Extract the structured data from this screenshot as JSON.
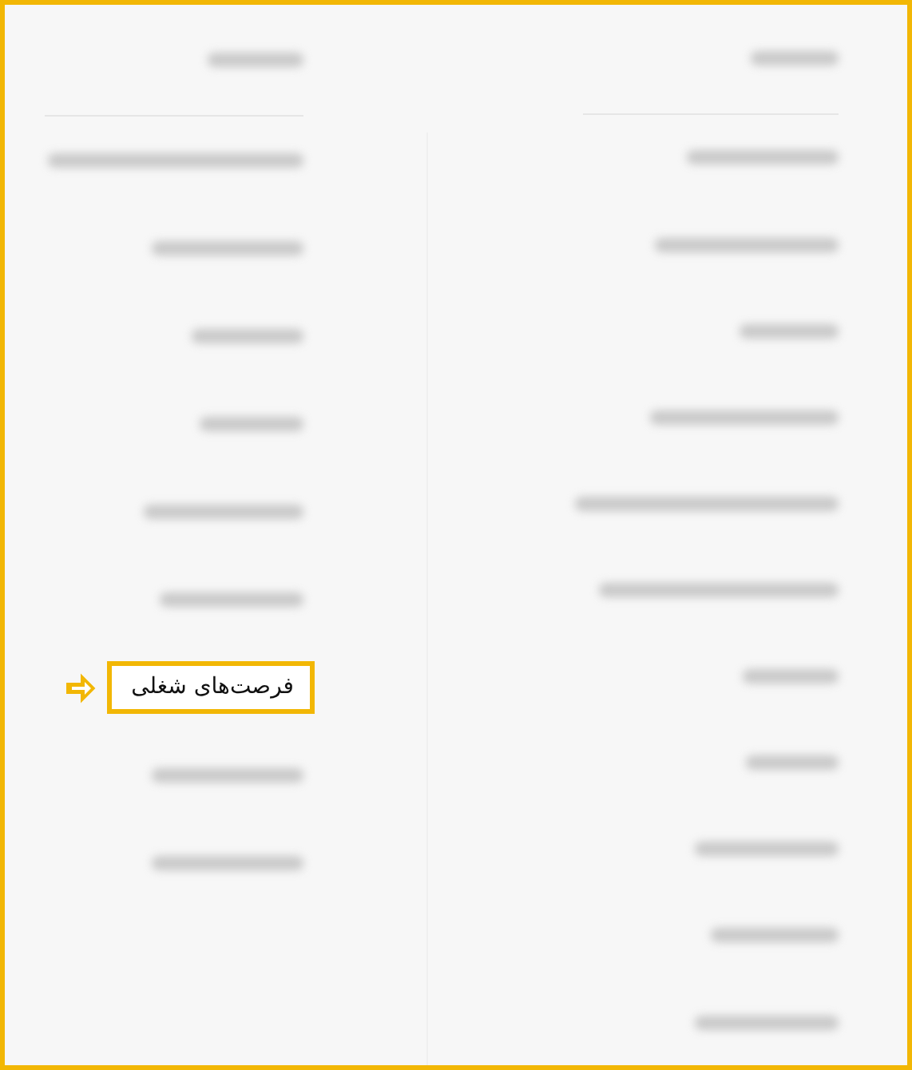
{
  "columns": [
    {
      "heading": {
        "kind": "blurred"
      },
      "items": [
        {
          "kind": "blurred"
        },
        {
          "kind": "blurred"
        },
        {
          "kind": "blurred"
        },
        {
          "kind": "blurred"
        },
        {
          "kind": "blurred"
        },
        {
          "kind": "blurred"
        },
        {
          "kind": "blurred"
        },
        {
          "kind": "blurred"
        },
        {
          "kind": "blurred"
        },
        {
          "kind": "blurred"
        },
        {
          "kind": "blurred"
        }
      ]
    },
    {
      "heading": {
        "kind": "blurred"
      },
      "items": [
        {
          "kind": "blurred"
        },
        {
          "kind": "blurred"
        },
        {
          "kind": "blurred"
        },
        {
          "kind": "blurred"
        },
        {
          "kind": "blurred"
        },
        {
          "kind": "blurred"
        },
        {
          "kind": "link",
          "label": "فرصت‌های شغلی",
          "highlighted": true
        },
        {
          "kind": "blurred"
        },
        {
          "kind": "blurred"
        }
      ]
    }
  ]
}
